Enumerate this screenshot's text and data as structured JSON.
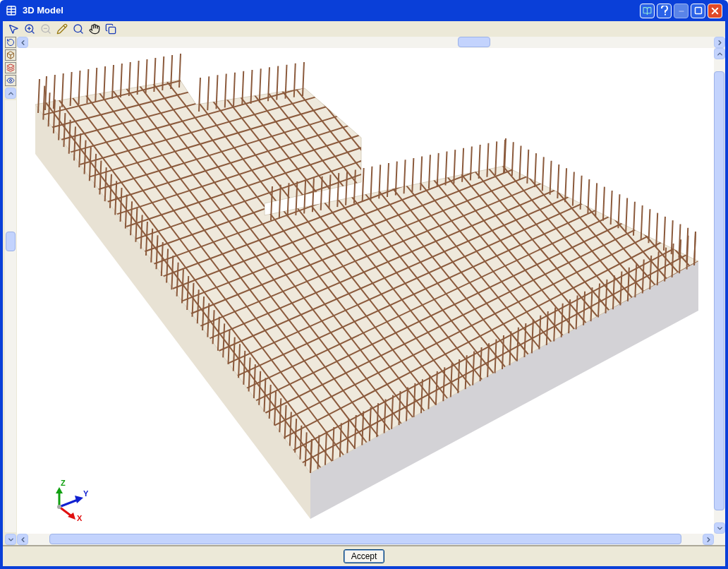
{
  "window": {
    "title": "3D Model"
  },
  "toolbar": [
    {
      "disabled": false
    },
    {
      "disabled": false
    },
    {
      "disabled": true
    },
    {
      "disabled": false
    },
    {
      "disabled": false
    },
    {
      "disabled": false
    },
    {
      "disabled": false
    }
  ],
  "side_toolbar": [
    {
      "disabled": false
    },
    {
      "disabled": false
    },
    {
      "disabled": false
    },
    {
      "disabled": false
    }
  ],
  "axes": {
    "x": "X",
    "y": "Y",
    "z": "Z"
  },
  "buttons": [
    "Accept"
  ]
}
